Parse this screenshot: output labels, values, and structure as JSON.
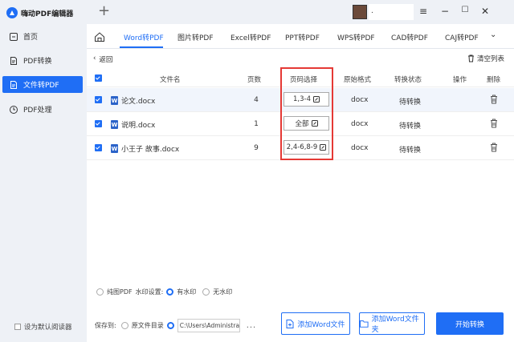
{
  "app": {
    "title": "嗨动PDF编辑器",
    "user": "."
  },
  "sidebar": {
    "items": [
      {
        "label": "首页",
        "icon": "home-icon"
      },
      {
        "label": "PDF转换",
        "icon": "pdf-convert-icon"
      },
      {
        "label": "文件转PDF",
        "icon": "file-to-pdf-icon"
      },
      {
        "label": "PDF处理",
        "icon": "pdf-process-icon"
      }
    ],
    "active_index": 2,
    "default_reader": "设为默认阅读器"
  },
  "tabs": [
    "Word转PDF",
    "图片转PDF",
    "Excel转PDF",
    "PPT转PDF",
    "WPS转PDF",
    "CAD转PDF",
    "CAJ转PDF"
  ],
  "panel": {
    "back": "返回",
    "clear": "清空列表"
  },
  "table": {
    "headers": {
      "name": "文件名",
      "pages": "页数",
      "range": "页码选择",
      "format": "原始格式",
      "status": "转换状态",
      "action": "操作",
      "delete": "删除"
    },
    "rows": [
      {
        "name": "论文.docx",
        "pages": "4",
        "range": "1,3-4",
        "format": "docx",
        "status": "待转换"
      },
      {
        "name": "说明.docx",
        "pages": "1",
        "range": "全部",
        "format": "docx",
        "status": "待转换"
      },
      {
        "name": "小王子 故事.docx",
        "pages": "9",
        "range": "2,4-6,8-9",
        "format": "docx",
        "status": "待转换"
      }
    ]
  },
  "watermark": {
    "option1": "纯图PDF",
    "label": "水印设置:",
    "option2": "有水印",
    "option3": "无水印"
  },
  "save": {
    "label": "保存到:",
    "option": "原文件目录",
    "path": "C:\\Users\\Administra...",
    "dots": "..."
  },
  "buttons": {
    "add_word": "添加Word文件",
    "add_folder": "添加Word文件夹",
    "start": "开始转换"
  },
  "colors": {
    "accent": "#1f6ef5",
    "highlight": "#e53935"
  }
}
